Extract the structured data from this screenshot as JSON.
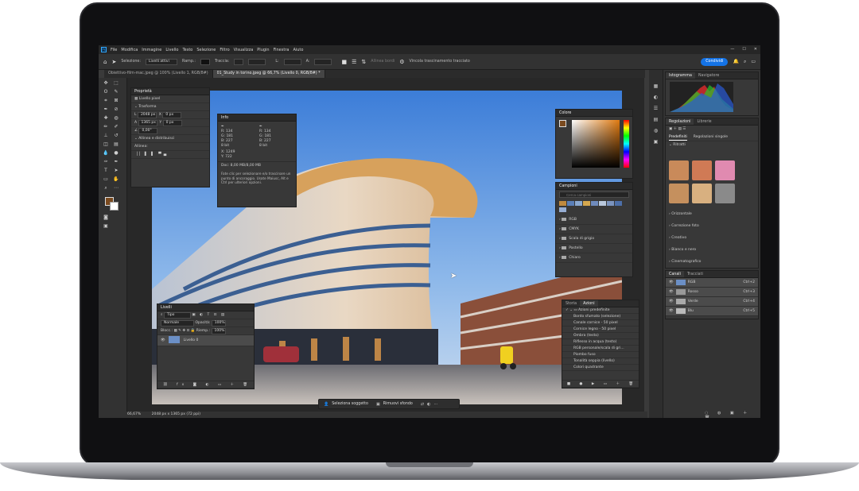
{
  "app": {
    "logo": "Ps"
  },
  "menubar": {
    "items": [
      "File",
      "Modifica",
      "Immagine",
      "Livello",
      "Testo",
      "Selezione",
      "Filtro",
      "Visualizza",
      "Plugin",
      "Finestra",
      "Aiuto"
    ]
  },
  "options": {
    "selection_label": "Selezione:",
    "selection_value": "Livelli attivi",
    "ramp_label": "Ramp.:",
    "stroke_label": "Traccia:",
    "align_edges": "Allinea bordi",
    "constrain_path": "Vincola trascinamento tracciato",
    "share_button": "Condividi"
  },
  "tabs": [
    {
      "label": "Obiettivo-film-mac.jpeg @ 100% (Livello 1, RGB/8#)"
    },
    {
      "label": "01_Study in torino.jpeg @ 66,7% (Livello 0, RGB/8#) *"
    }
  ],
  "status": {
    "zoom": "66,67%",
    "doc_size": "2048 px x 1365 px (72 ppi)"
  },
  "contextbar": {
    "select_subject": "Seleziona soggetto",
    "remove_bg": "Rimuovi sfondo"
  },
  "properties": {
    "title": "Proprietà",
    "layer_type": "Livello pixel",
    "transform_title": "Trasforma",
    "w": "2048 px",
    "h": "1365 px",
    "x": "0 px",
    "y": "0 px",
    "angle": "0,00°",
    "align_title": "Allinea e distribuisci",
    "align_label": "Allinea:"
  },
  "info": {
    "title": "Info",
    "r1": "134",
    "g1": "181",
    "b1": "227",
    "r2": "134",
    "g2": "181",
    "b2": "227",
    "bit1": "8 bit",
    "bit2": "8 bit",
    "x": "1249",
    "y": "722",
    "doc": "Doc: 8,00 MB/8,00 MB",
    "hint": "Fate clic per selezionare e/o trascinare un punto di ancoraggio. Usate Maiusc, Alt e Ctrl per ulteriori opzioni."
  },
  "layers": {
    "title": "Livelli",
    "filter": "Tipo",
    "blend": "Normale",
    "opacity_label": "Opacità:",
    "opacity": "100%",
    "lock_label": "Blocc.:",
    "fill_label": "Riemp.:",
    "fill": "100%",
    "layer_name": "Livello 0"
  },
  "color": {
    "title": "Colore"
  },
  "swatches": {
    "title": "Campioni",
    "search_placeholder": "Cerca campioni",
    "colors": [
      "#c08a3e",
      "#5a7fb8",
      "#8aa8d0",
      "#d4a84f",
      "#6f8bbd",
      "#b9c8dc",
      "#7b94bf",
      "#4d6fa9",
      "#96add2"
    ],
    "groups": [
      "RGB",
      "CMYK",
      "Scala di grigio",
      "Pastello",
      "Chiaro"
    ]
  },
  "history_actions": {
    "tab_history": "Storia",
    "tab_actions": "Azioni",
    "set_name": "Azioni predefinite",
    "items": [
      "Bordo sfumato (selezione)",
      "Canale cornice - 50 pixel",
      "Cornice legno - 50 pixel",
      "Ombra (testo)",
      "Riflesso in acqua (testo)",
      "RGB personale/scala di gri...",
      "Piombo fuso",
      "Tonalità seppia (livello)",
      "Colori quadrante"
    ]
  },
  "histogram": {
    "tab1": "Istogramma",
    "tab2": "Navigatore"
  },
  "adjustments": {
    "tab1": "Regolazioni",
    "tab2": "Librerie",
    "sub1": "Predefiniti",
    "sub2": "Regolazioni singole",
    "group_open": "Ritratti",
    "groups": [
      "Orizzontale",
      "Correzione foto",
      "Creativo",
      "Bianco e nero",
      "Cinematografico"
    ]
  },
  "channels": {
    "tab1": "Canali",
    "tab2": "Tracciati",
    "items": [
      {
        "name": "RGB",
        "shortcut": "Ctrl+2"
      },
      {
        "name": "Rosso",
        "shortcut": "Ctrl+3"
      },
      {
        "name": "Verde",
        "shortcut": "Ctrl+4"
      },
      {
        "name": "Blu",
        "shortcut": "Ctrl+5"
      }
    ]
  },
  "accent_colors": {
    "share": "#1473e6",
    "foreground": "#7a4a1f",
    "background": "#ffffff"
  }
}
